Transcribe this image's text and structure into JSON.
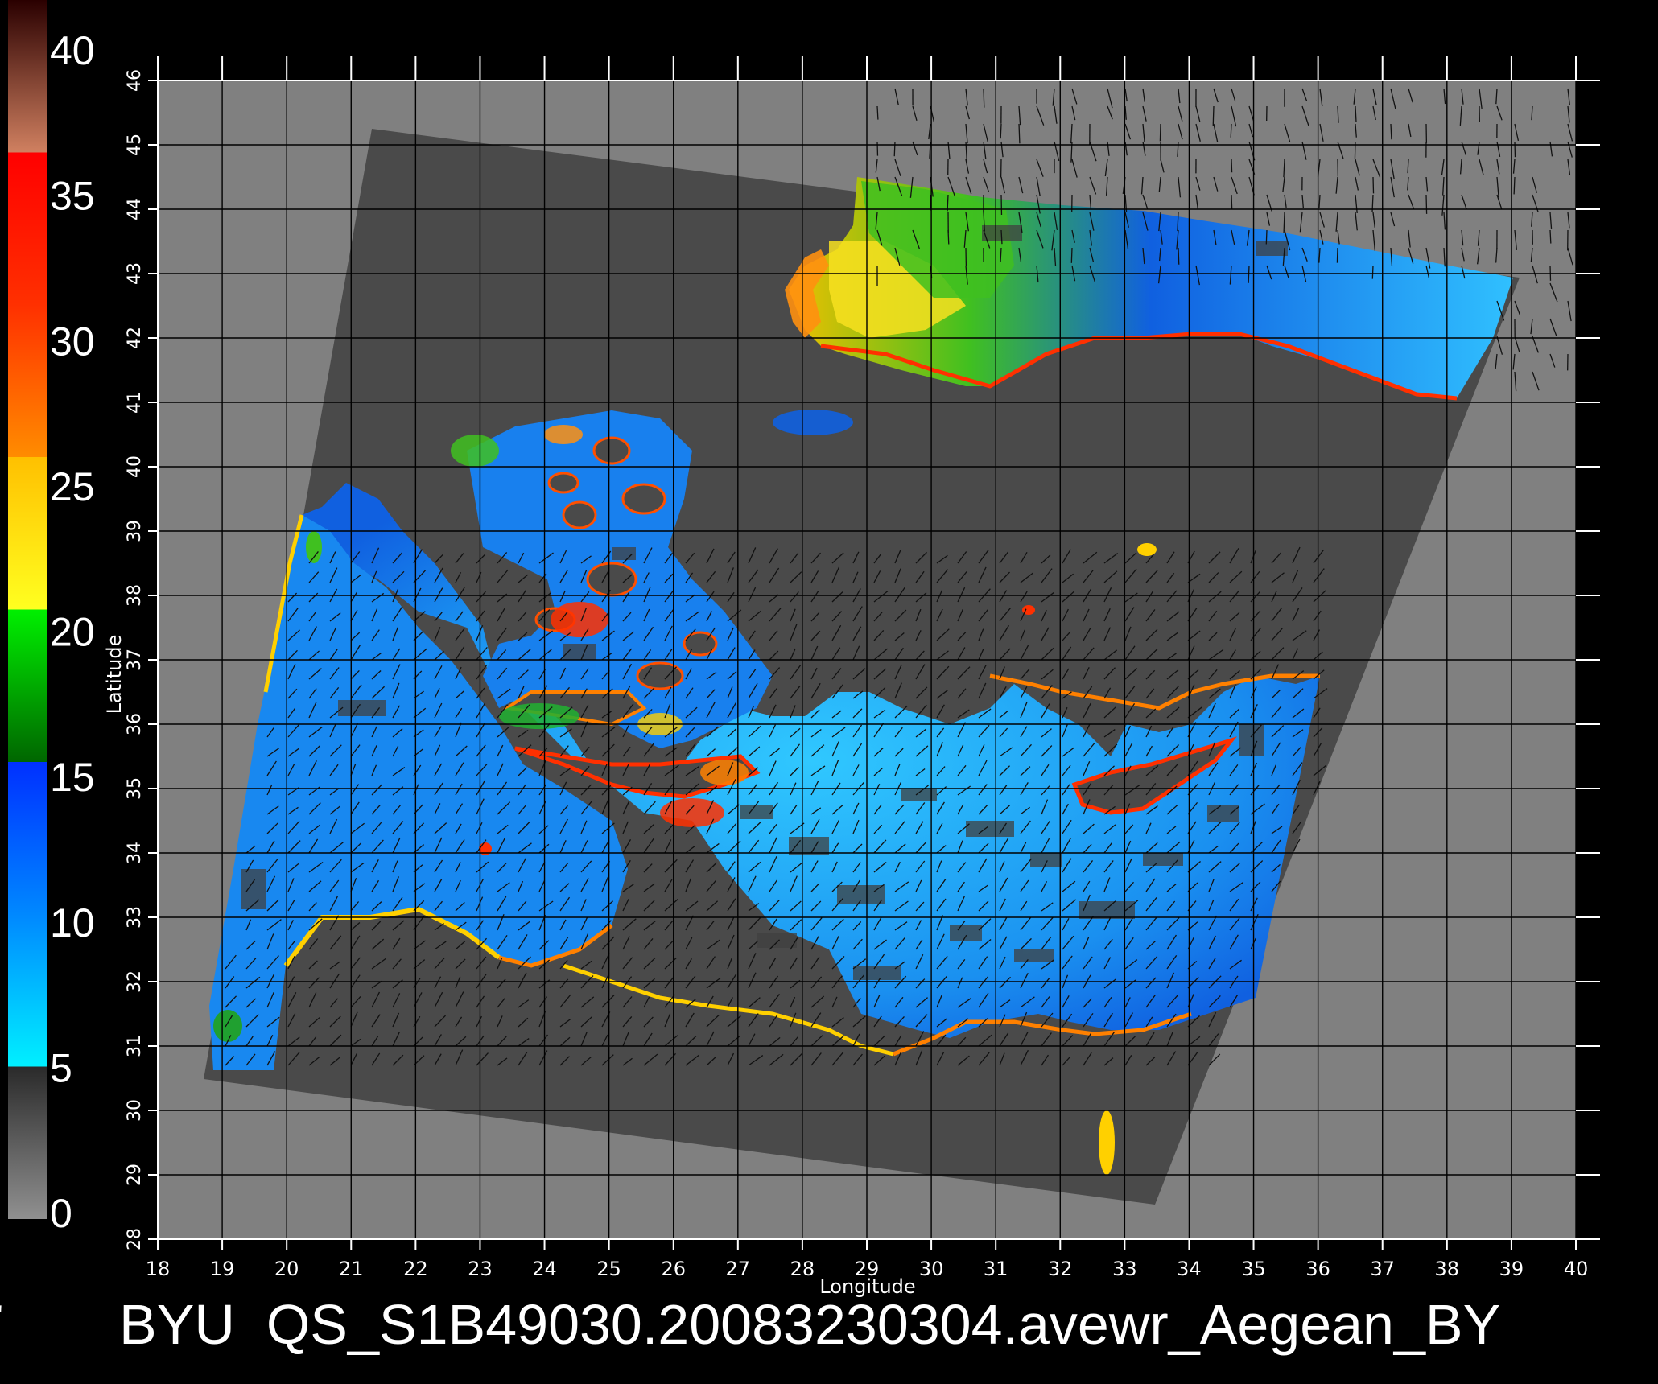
{
  "title": "BYU  QS_S1B49030.20083230304.avewr_Aegean_BY",
  "x_axis": {
    "label": "Longitude",
    "ticks": [
      "18",
      "19",
      "20",
      "21",
      "22",
      "23",
      "24",
      "25",
      "26",
      "27",
      "28",
      "29",
      "30",
      "31",
      "32",
      "33",
      "34",
      "35",
      "36",
      "37",
      "38",
      "39",
      "40"
    ]
  },
  "y_axis": {
    "label": "Latitude",
    "ticks": [
      "28",
      "29",
      "30",
      "31",
      "32",
      "33",
      "34",
      "35",
      "36",
      "37",
      "38",
      "39",
      "40",
      "41",
      "42",
      "43",
      "44",
      "45",
      "46"
    ]
  },
  "colorbar": {
    "labels": [
      "0",
      "5",
      "10",
      "15",
      "20",
      "25",
      "30",
      "35",
      "40"
    ],
    "stops": [
      {
        "value": 0,
        "color": "#808080"
      },
      {
        "value": 5,
        "color": "#303030"
      },
      {
        "value": 5.01,
        "color": "#00ffff"
      },
      {
        "value": 10,
        "color": "#0090ff"
      },
      {
        "value": 15,
        "color": "#0030ff"
      },
      {
        "value": 15.01,
        "color": "#007000"
      },
      {
        "value": 20,
        "color": "#00ff00"
      },
      {
        "value": 20.01,
        "color": "#ffff00"
      },
      {
        "value": 25,
        "color": "#ffc000"
      },
      {
        "value": 25.01,
        "color": "#ff8000"
      },
      {
        "value": 30,
        "color": "#ff3000"
      },
      {
        "value": 35,
        "color": "#ff0000"
      },
      {
        "value": 35.01,
        "color": "#c07050"
      },
      {
        "value": 40,
        "color": "#300000"
      },
      {
        "value": 40.01,
        "color": "#ff00ff"
      }
    ]
  },
  "colors": {
    "background": "#000000",
    "plot_area": "#808080",
    "swath_land": "#4a4a4a",
    "grid": "#000000",
    "text": "#ffffff"
  }
}
